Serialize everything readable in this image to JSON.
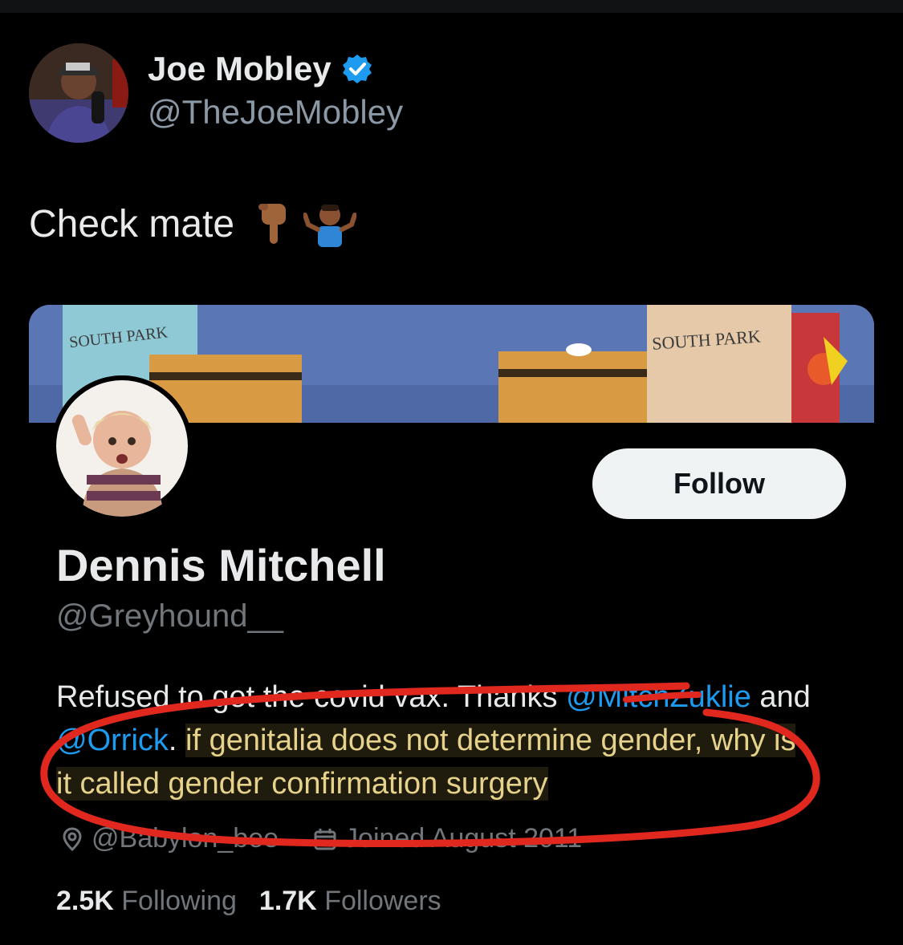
{
  "tweet": {
    "author_name": "Joe Mobley",
    "author_handle": "@TheJoeMobley",
    "text": "Check mate",
    "emojis": [
      "pointing-down-emoji",
      "shrug-emoji"
    ]
  },
  "profile_card": {
    "banner_text_left": "SOUTH PARK",
    "banner_text_right": "SOUTH PARK",
    "follow_label": "Follow",
    "name": "Dennis Mitchell",
    "handle": "@Greyhound__",
    "bio": {
      "part1": "Refused to get the covid vax. Thanks ",
      "mention1": "@MitchZuklie",
      "part2": " and ",
      "mention2": "@Orrick",
      "part3": ". ",
      "highlighted": "if genitalia does not determine gender, why is it called gender confirmation surgery"
    },
    "location": "@Babylon_bee",
    "joined": "Joined August 2011",
    "following_count": "2.5K",
    "following_label": "Following",
    "followers_count": "1.7K",
    "followers_label": "Followers"
  },
  "colors": {
    "background": "#000000",
    "mention": "#1d9bf0",
    "verified": "#1d9bf0",
    "annotation": "#e0281e",
    "highlight_text": "#e6d28a"
  }
}
